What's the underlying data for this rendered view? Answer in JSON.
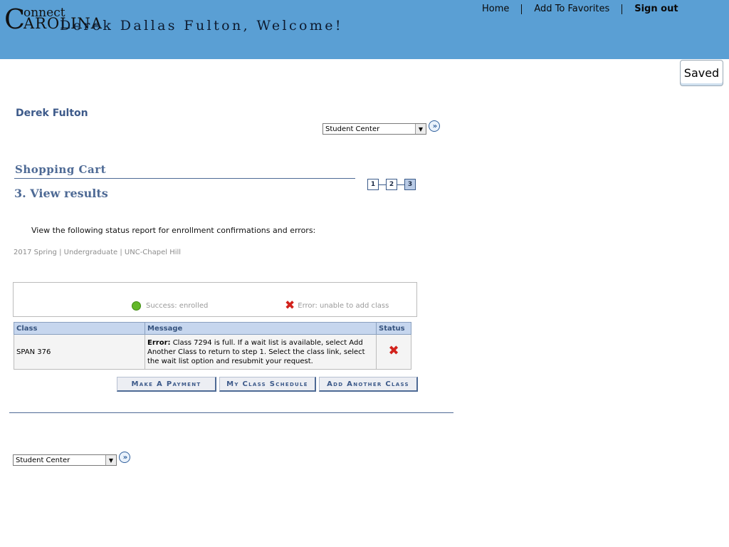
{
  "header": {
    "logo": {
      "big_c": "C",
      "line1": "onnect",
      "line2": "AROLINA"
    },
    "welcome": "Derek Dallas Fulton, Welcome!",
    "nav": [
      {
        "label": "Home"
      },
      {
        "label": "Add To Favorites"
      },
      {
        "label": "Sign out"
      }
    ]
  },
  "saved_button": "Saved",
  "user_name": "Derek Fulton",
  "top_select": {
    "value": "Student Center"
  },
  "bottom_select": {
    "value": "Student Center"
  },
  "page": {
    "title": "Shopping Cart",
    "step_title": "3.  View results",
    "steps": [
      "1",
      "2",
      "3"
    ],
    "current_step": 3,
    "instruction": "View the following status report for enrollment confirmations and errors:",
    "term": "2017 Spring | Undergraduate | UNC-Chapel Hill"
  },
  "legend": {
    "success": "Success: enrolled",
    "error": "Error: unable to add class"
  },
  "results_table": {
    "headers": [
      "Class",
      "Message",
      "Status"
    ],
    "rows": [
      {
        "class": "SPAN  376",
        "message_label": "Error:",
        "message": "Class 7294 is full. If a wait list is available, select Add Another Class to return to step 1. Select the class link, select the wait list option and resubmit your request.",
        "status_icon": "error-x-icon"
      }
    ]
  },
  "actions": {
    "make_payment": "Make A Payment",
    "class_schedule": "My Class Schedule",
    "add_another": "Add Another Class"
  },
  "colors": {
    "header_bg": "#5a9fd4",
    "heading": "#4e6a95",
    "table_header_bg": "#c6d6ee",
    "success": "#63b829",
    "error": "#d2221c"
  }
}
